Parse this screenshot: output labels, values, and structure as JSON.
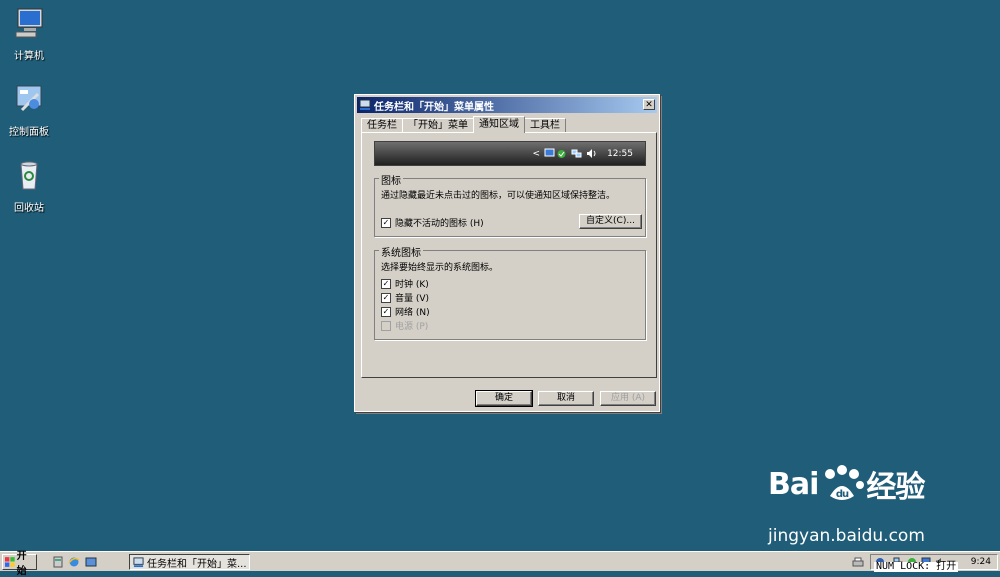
{
  "desktop": {
    "icons": [
      {
        "label": "计算机"
      },
      {
        "label": "控制面板"
      },
      {
        "label": "回收站"
      }
    ]
  },
  "dialog": {
    "title": "任务栏和「开始」菜单属性",
    "close_label": "✕",
    "tabs": [
      {
        "label": "任务栏",
        "active": false
      },
      {
        "label": "「开始」菜单",
        "active": false
      },
      {
        "label": "通知区域",
        "active": true
      },
      {
        "label": "工具栏",
        "active": false
      }
    ],
    "preview": {
      "arrow": "<",
      "clock": "12:55"
    },
    "icons_group": {
      "legend": "图标",
      "description": "通过隐藏最近未点击过的图标，可以使通知区域保持整洁。",
      "hide_inactive": {
        "label": "隐藏不活动的图标 (H)",
        "checked": true
      },
      "customize_button": "自定义(C)..."
    },
    "system_icons_group": {
      "legend": "系统图标",
      "description": "选择要始终显示的系统图标。",
      "items": [
        {
          "label": "时钟 (K)",
          "checked": true,
          "disabled": false
        },
        {
          "label": "音量 (V)",
          "checked": true,
          "disabled": false
        },
        {
          "label": "网络 (N)",
          "checked": true,
          "disabled": false
        },
        {
          "label": "电源 (P)",
          "checked": false,
          "disabled": true
        }
      ]
    },
    "buttons": {
      "ok": "确定",
      "cancel": "取消",
      "apply": "应用 (A)"
    }
  },
  "taskbar": {
    "start_label": "开始",
    "task_button_label": "任务栏和「开始」菜...",
    "tray_time": "9:24",
    "numlock_text": "NUM LOCK: 打开"
  },
  "watermark": {
    "brand": "Bai",
    "brand_tail": "经验",
    "url": "jingyan.baidu.com"
  },
  "colors": {
    "desktop": "#1f5d78",
    "titlebar_start": "#0a246a",
    "titlebar_end": "#a6caf0",
    "face": "#d4d0c8"
  }
}
